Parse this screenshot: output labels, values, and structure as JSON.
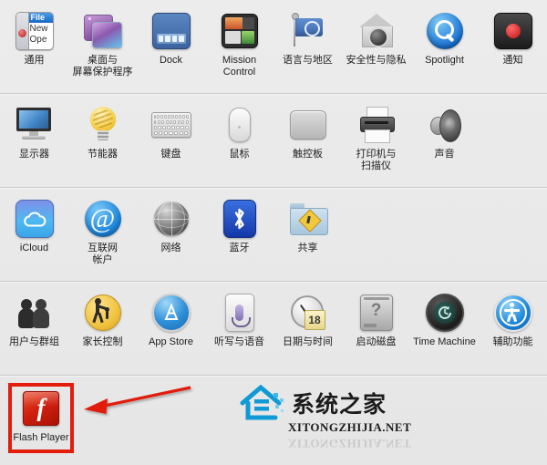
{
  "window": {
    "app": "System Preferences",
    "background_color": "#eaeaea",
    "separator_color": "#c9c9c9"
  },
  "rows": [
    {
      "name": "personal",
      "items": [
        {
          "label": "通用",
          "icon": "general-icon"
        },
        {
          "label": "桌面与\n屏幕保护程序",
          "line1": "桌面与",
          "line2": "屏幕保护程序",
          "icon": "desktop-screensaver-icon"
        },
        {
          "label": "Dock",
          "icon": "dock-icon"
        },
        {
          "label": "Mission\nControl",
          "line1": "Mission",
          "line2": "Control",
          "icon": "mission-control-icon"
        },
        {
          "label": "语言与地区",
          "icon": "language-region-icon"
        },
        {
          "label": "安全性与隐私",
          "icon": "security-privacy-icon"
        },
        {
          "label": "Spotlight",
          "icon": "spotlight-icon"
        },
        {
          "label": "通知",
          "icon": "notifications-icon"
        }
      ]
    },
    {
      "name": "hardware",
      "items": [
        {
          "label": "显示器",
          "icon": "displays-icon"
        },
        {
          "label": "节能器",
          "icon": "energy-saver-icon"
        },
        {
          "label": "键盘",
          "icon": "keyboard-icon"
        },
        {
          "label": "鼠标",
          "icon": "mouse-icon"
        },
        {
          "label": "触控板",
          "icon": "trackpad-icon"
        },
        {
          "label": "打印机与\n扫描仪",
          "line1": "打印机与",
          "line2": "扫描仪",
          "icon": "printers-scanners-icon"
        },
        {
          "label": "声音",
          "icon": "sound-icon"
        }
      ]
    },
    {
      "name": "internet-wireless",
      "items": [
        {
          "label": "iCloud",
          "icon": "icloud-icon"
        },
        {
          "label": "互联网\n帐户",
          "line1": "互联网",
          "line2": "帐户",
          "icon": "internet-accounts-icon"
        },
        {
          "label": "网络",
          "icon": "network-icon"
        },
        {
          "label": "蓝牙",
          "icon": "bluetooth-icon"
        },
        {
          "label": "共享",
          "icon": "sharing-icon"
        }
      ]
    },
    {
      "name": "system",
      "items": [
        {
          "label": "用户与群组",
          "icon": "users-groups-icon"
        },
        {
          "label": "家长控制",
          "icon": "parental-controls-icon"
        },
        {
          "label": "App Store",
          "icon": "app-store-icon"
        },
        {
          "label": "听写与语音",
          "icon": "dictation-speech-icon"
        },
        {
          "label": "日期与时间",
          "icon": "date-time-icon",
          "badge": "18"
        },
        {
          "label": "启动磁盘",
          "icon": "startup-disk-icon"
        },
        {
          "label": "Time Machine",
          "icon": "time-machine-icon"
        },
        {
          "label": "辅助功能",
          "icon": "accessibility-icon"
        }
      ]
    }
  ],
  "third_party": {
    "items": [
      {
        "label": "Flash Player",
        "icon": "flash-player-icon",
        "highlighted": true
      }
    ],
    "highlight": {
      "color": "#e21d0c",
      "border_width": 4
    },
    "annotation_arrow": {
      "color": "#e21d0c",
      "direction": "left",
      "points_to": "flash-player-icon"
    }
  },
  "watermark": {
    "chinese": "系统之家",
    "english": "XITONGZHIJIA.NET",
    "logo": "house-logo-icon",
    "logo_color": "#0f9ad6"
  }
}
